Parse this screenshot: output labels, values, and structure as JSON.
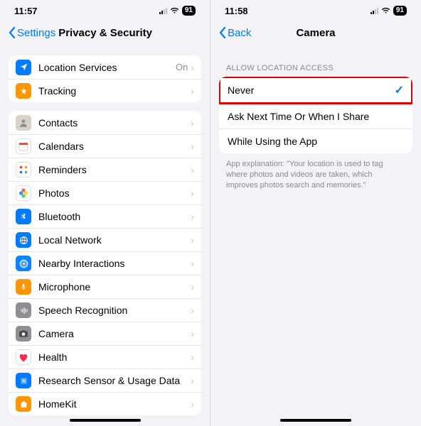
{
  "left": {
    "status": {
      "time": "11:57",
      "battery": "91"
    },
    "nav": {
      "back": "Settings",
      "title": "Privacy & Security"
    },
    "group1": [
      {
        "label": "Location Services",
        "value": "On",
        "icon": "location",
        "bg": "#007aff"
      },
      {
        "label": "Tracking",
        "value": "",
        "icon": "tracking",
        "bg": "#ff9500"
      }
    ],
    "group2": [
      {
        "label": "Contacts",
        "icon": "contacts",
        "bg": "#d8d2c8"
      },
      {
        "label": "Calendars",
        "icon": "calendars",
        "bg": "#ffffff"
      },
      {
        "label": "Reminders",
        "icon": "reminders",
        "bg": "#ffffff"
      },
      {
        "label": "Photos",
        "icon": "photos",
        "bg": "#ffffff"
      },
      {
        "label": "Bluetooth",
        "icon": "bluetooth",
        "bg": "#007aff"
      },
      {
        "label": "Local Network",
        "icon": "localnetwork",
        "bg": "#007aff"
      },
      {
        "label": "Nearby Interactions",
        "icon": "nearby",
        "bg": "#0a84ff"
      },
      {
        "label": "Microphone",
        "icon": "microphone",
        "bg": "#ff9500"
      },
      {
        "label": "Speech Recognition",
        "icon": "speech",
        "bg": "#8e8e93"
      },
      {
        "label": "Camera",
        "icon": "camera",
        "bg": "#8e8e93"
      },
      {
        "label": "Health",
        "icon": "health",
        "bg": "#ffffff"
      },
      {
        "label": "Research Sensor & Usage Data",
        "icon": "research",
        "bg": "#007aff"
      },
      {
        "label": "HomeKit",
        "icon": "homekit",
        "bg": "#ff9500"
      }
    ]
  },
  "right": {
    "status": {
      "time": "11:58",
      "battery": "91"
    },
    "nav": {
      "back": "Back",
      "title": "Camera"
    },
    "sectionHeader": "Allow Location Access",
    "options": [
      {
        "label": "Never",
        "selected": true,
        "highlight": true
      },
      {
        "label": "Ask Next Time Or When I Share",
        "selected": false,
        "highlight": false
      },
      {
        "label": "While Using the App",
        "selected": false,
        "highlight": false
      }
    ],
    "footer": "App explanation: \"Your location is used to tag where photos and videos are taken, which improves photos search and memories.\""
  },
  "colors": {
    "accent": "#007aff",
    "highlight": "#e40000"
  }
}
